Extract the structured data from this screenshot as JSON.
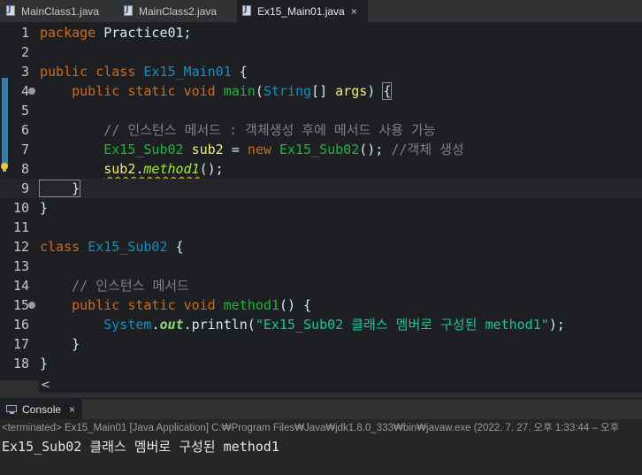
{
  "tabs": [
    {
      "label": "MainClass1.java",
      "icon": "java-file-icon",
      "active": false
    },
    {
      "label": "MainClass2.java",
      "icon": "java-file-icon",
      "active": false
    },
    {
      "label": "Ex15_Main01.java",
      "icon": "java-file-icon",
      "active": true,
      "close": "×"
    }
  ],
  "editor": {
    "line_numbers": [
      "1",
      "2",
      "3",
      "4",
      "5",
      "6",
      "7",
      "8",
      "9",
      "10",
      "11",
      "12",
      "13",
      "14",
      "15",
      "16",
      "17",
      "18"
    ],
    "tokens": {
      "l1_kw": "package",
      "l1_rest": " Practice01;",
      "l3_kw1": "public",
      "l3_kw2": "class",
      "l3_cls": "Ex15_Main01",
      "l3_rest": " {",
      "l4_indent": "    ",
      "l4_kw1": "public",
      "l4_kw2": "static",
      "l4_kw3": "void",
      "l4_mth": "main",
      "l4_p1": "(",
      "l4_cls": "String",
      "l4_p2": "[] ",
      "l4_var": "args",
      "l4_p3": ") ",
      "l4_brace": "{",
      "l6_cmt": "        // 인스턴스 메서드 : 객체생성 후에 메서드 사용 가능",
      "l7_indent": "        ",
      "l7_cls1": "Ex15_Sub02",
      "l7_var": " sub2",
      "l7_eq": " = ",
      "l7_kw": "new",
      "l7_cls2": " Ex15_Sub02",
      "l7_p": "(); ",
      "l7_cmt": "//객체 생성",
      "l8_indent": "        ",
      "l8_var": "sub2",
      "l8_dot": ".",
      "l8_meth": "method1",
      "l8_rest": "();",
      "l9_text": "    }",
      "l10_text": "}",
      "l12_kw": "class",
      "l12_cls": "Ex15_Sub02",
      "l12_rest": " {",
      "l14_cmt": "    // 인스턴스 메서드",
      "l15_indent": "    ",
      "l15_kw1": "public",
      "l15_kw2": "static",
      "l15_kw3": "void",
      "l15_mth": "method1",
      "l15_rest": "() {",
      "l16_indent": "        ",
      "l16_cls": "System",
      "l16_dot": ".",
      "l16_fld": "out",
      "l16_p": ".println(",
      "l16_str": "\"Ex15_Sub02 클래스 멤버로 구성된 method1\"",
      "l16_end": ");",
      "l17_text": "    }",
      "l18_text": "}"
    },
    "scroll_left_arrow": "<"
  },
  "console": {
    "tab_label": "Console",
    "tab_close": "×",
    "status": "<terminated> Ex15_Main01 [Java Application] C:₩Program Files₩Java₩jdk1.8.0_333₩bin₩javaw.exe  (2022. 7. 27. 오후 1:33:44 – 오후",
    "output": "Ex15_Sub02 클래스 멤버로 구성된 method1"
  },
  "colors": {
    "keyword": "#cc6c1d",
    "class": "#1290c3",
    "method": "#1eb540",
    "variable": "#f3ec79",
    "string": "#17c6a3",
    "comment": "#808080"
  }
}
